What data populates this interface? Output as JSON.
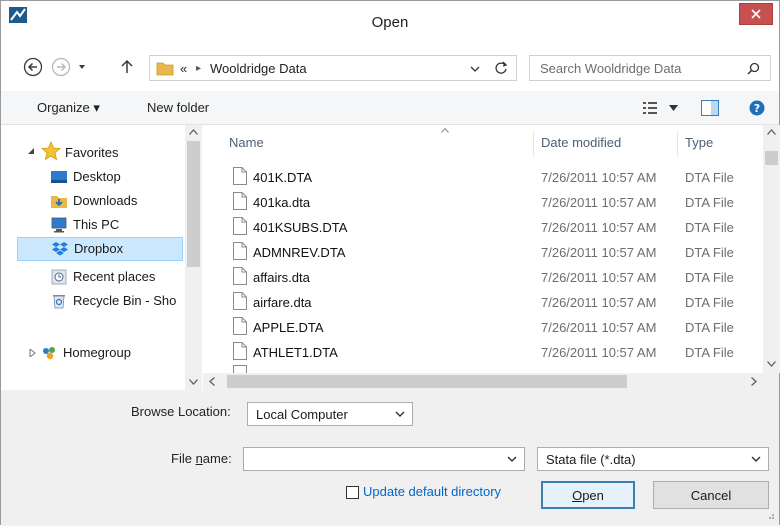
{
  "window": {
    "title": "Open",
    "close_label": "×"
  },
  "nav": {
    "back_icon": "back-arrow-circle",
    "forward_icon": "forward-arrow-circle",
    "recent_icon": "chevron-down",
    "up_icon": "up-arrow"
  },
  "address": {
    "overflow": "«",
    "separator": "▸",
    "current": "Wooldridge Data",
    "refresh_icon": "refresh"
  },
  "search": {
    "placeholder": "Search Wooldridge Data"
  },
  "toolbar": {
    "organize_label": "Organize ▾",
    "new_folder_label": "New folder"
  },
  "sidebar": {
    "favorites_label": "Favorites",
    "items": [
      {
        "label": "Desktop",
        "icon": "desktop-icon"
      },
      {
        "label": "Downloads",
        "icon": "downloads-icon"
      },
      {
        "label": "This PC",
        "icon": "computer-icon"
      },
      {
        "label": "Dropbox",
        "icon": "dropbox-icon",
        "selected": true
      },
      {
        "label": "Recent places",
        "icon": "recent-places-icon"
      },
      {
        "label": "Recycle Bin - Sho",
        "icon": "recycle-bin-icon"
      }
    ],
    "homegroup_label": "Homegroup"
  },
  "files": {
    "columns": [
      "Name",
      "Date modified",
      "Type"
    ],
    "rows": [
      {
        "name": "401K.DTA",
        "date": "7/26/2011 10:57 AM",
        "type": "DTA File"
      },
      {
        "name": "401ka.dta",
        "date": "7/26/2011 10:57 AM",
        "type": "DTA File"
      },
      {
        "name": "401KSUBS.DTA",
        "date": "7/26/2011 10:57 AM",
        "type": "DTA File"
      },
      {
        "name": "ADMNREV.DTA",
        "date": "7/26/2011 10:57 AM",
        "type": "DTA File"
      },
      {
        "name": "affairs.dta",
        "date": "7/26/2011 10:57 AM",
        "type": "DTA File"
      },
      {
        "name": "airfare.dta",
        "date": "7/26/2011 10:57 AM",
        "type": "DTA File"
      },
      {
        "name": "APPLE.DTA",
        "date": "7/26/2011 10:57 AM",
        "type": "DTA File"
      },
      {
        "name": "ATHLET1.DTA",
        "date": "7/26/2011 10:57 AM",
        "type": "DTA File"
      }
    ]
  },
  "bottom": {
    "browse_location_label": "Browse Location:",
    "browse_location_value": "Local Computer",
    "file_name_prefix": "File ",
    "file_name_underlined": "n",
    "file_name_suffix": "ame:",
    "file_name_value": "",
    "file_type_value": "Stata file (*.dta)",
    "update_default_label": "Update default directory",
    "open_underlined": "O",
    "open_rest": "pen",
    "cancel_label": "Cancel"
  },
  "colors": {
    "selection": "#cce8ff",
    "close": "#c75050",
    "link": "#0066cc"
  }
}
